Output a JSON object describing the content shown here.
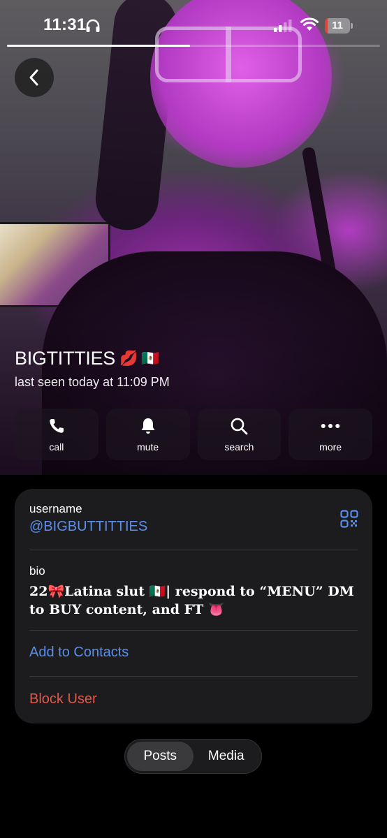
{
  "status_bar": {
    "time": "11:31",
    "battery_level": "11",
    "battery_fraction": 0.11,
    "icons": [
      "headphones-icon",
      "cellular-signal-icon",
      "wifi-icon",
      "battery-icon"
    ]
  },
  "story_progress": 0.49,
  "header": {
    "back_icon": "chevron-left-icon",
    "name": "BIGTITTIES",
    "name_emojis": "💋 🇲🇽",
    "last_seen": "last seen today at 11:09 PM"
  },
  "actions": [
    {
      "label": "call",
      "icon": "phone-icon"
    },
    {
      "label": "mute",
      "icon": "bell-icon"
    },
    {
      "label": "search",
      "icon": "search-icon"
    },
    {
      "label": "more",
      "icon": "ellipsis-icon"
    }
  ],
  "info": {
    "username_label": "username",
    "username_value": "@BIGBUTTITTIES",
    "bio_label": "bio",
    "bio_text": "22🎀Latina slut 🇲🇽| respond to “MENU” DM to BUY content, and FT 👅",
    "add_contact": "Add to Contacts",
    "block_user": "Block User"
  },
  "tabs": {
    "items": [
      "Posts",
      "Media"
    ],
    "selected": "Posts"
  },
  "colors": {
    "link_blue": "#5a8eea",
    "danger_red": "#e0584a",
    "card_bg": "#1c1c1e",
    "battery_red": "#e0413a"
  }
}
